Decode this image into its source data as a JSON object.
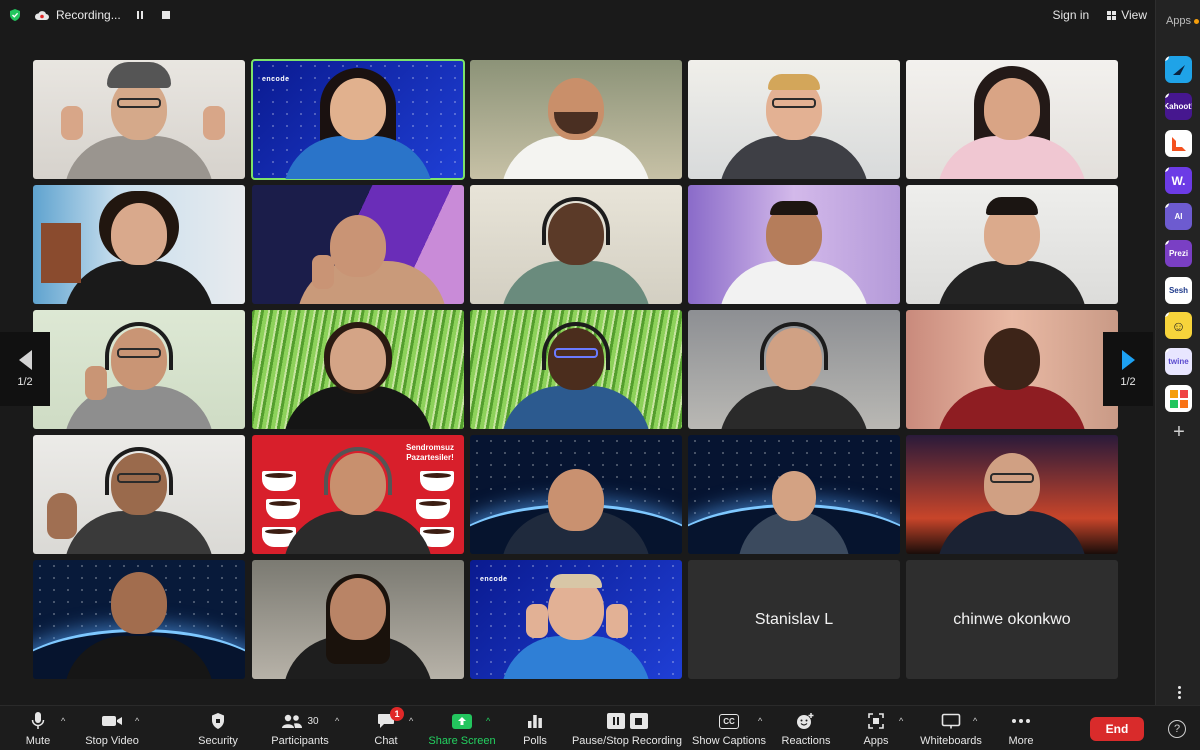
{
  "topbar": {
    "recording_label": "Recording...",
    "sign_in": "Sign in",
    "view": "View"
  },
  "apps_rail": {
    "title": "Apps",
    "apps": [
      {
        "label": "",
        "icon": "arrow-app-icon",
        "color": "#1fa3e8"
      },
      {
        "label": "Kahoot!",
        "icon": "kahoot-icon",
        "color": "#46178f"
      },
      {
        "label": "",
        "icon": "orange-square-app-icon",
        "color": "#f4511e"
      },
      {
        "label": "W.",
        "icon": "wooclap-icon",
        "color": "#6c3be6"
      },
      {
        "label": "AI",
        "icon": "ai-app-icon",
        "color": "#6d5bd0"
      },
      {
        "label": "Prezi",
        "icon": "prezi-icon",
        "color": "#7a3fc4"
      },
      {
        "label": "Sesh",
        "icon": "sesh-icon",
        "color": "#ffffff"
      },
      {
        "label": "",
        "icon": "smiley-app-icon",
        "color": "#f7d43b"
      },
      {
        "label": "twine",
        "icon": "twine-icon",
        "color": "#e8e6ff"
      },
      {
        "label": "",
        "icon": "blocks-app-icon",
        "color": "#ffffff"
      }
    ]
  },
  "gallery": {
    "page_left": "1/2",
    "page_right": "1/2",
    "name_tiles": [
      "Stanislav L",
      "chinwe okonkwo"
    ],
    "tile_texts": {
      "encode_logo": "encode",
      "banner_line1": "Sendromsuz",
      "banner_line2": "Pazartesiler!"
    }
  },
  "toolbar": {
    "items": [
      {
        "label": "Mute",
        "icon": "microphone-icon"
      },
      {
        "label": "Stop Video",
        "icon": "video-camera-icon"
      },
      {
        "label": "Security",
        "icon": "shield-icon"
      },
      {
        "label": "Participants",
        "icon": "participants-icon",
        "count": "30"
      },
      {
        "label": "Chat",
        "icon": "chat-icon",
        "badge": "1"
      },
      {
        "label": "Share Screen",
        "icon": "share-screen-icon"
      },
      {
        "label": "Polls",
        "icon": "polls-icon"
      },
      {
        "label": "Pause/Stop Recording",
        "icon": "recording-controls-icon"
      },
      {
        "label": "Show Captions",
        "icon": "captions-icon",
        "cc": "CC"
      },
      {
        "label": "Reactions",
        "icon": "reactions-icon"
      },
      {
        "label": "Apps",
        "icon": "apps-icon"
      },
      {
        "label": "Whiteboards",
        "icon": "whiteboard-icon"
      },
      {
        "label": "More",
        "icon": "more-icon"
      }
    ],
    "end": "End",
    "help": "?"
  },
  "colors": {
    "accent_green": "#23d160",
    "end_red": "#d92b2b",
    "active_speaker": "#7ce36a",
    "background": "#1a1a1a"
  }
}
